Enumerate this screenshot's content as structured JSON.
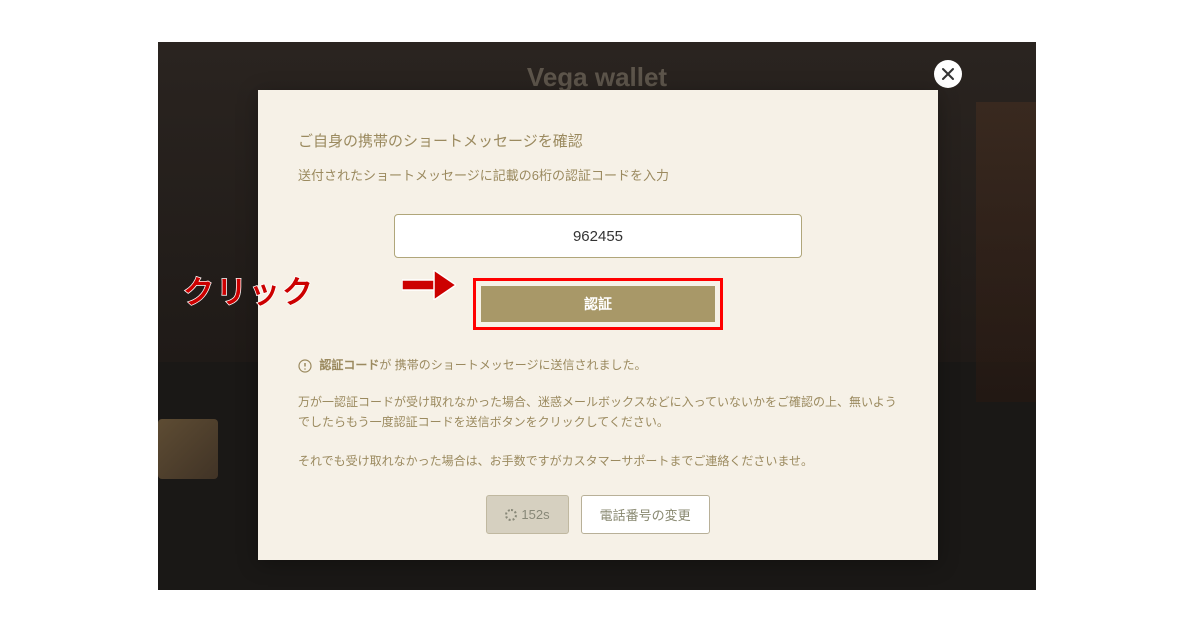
{
  "backdrop": {
    "title": "Vega wallet"
  },
  "modal": {
    "title": "ご自身の携帯のショートメッセージを確認",
    "subtitle": "送付されたショートメッセージに記載の6桁の認証コードを入力",
    "code_value": "962455",
    "verify_button_label": "認証",
    "info_prefix": "認証コード",
    "info_text": "が 携帯のショートメッセージに送信されました。",
    "body_text_1": "万が一認証コードが受け取れなかった場合、迷惑メールボックスなどに入っていないかをご確認の上、無いようでしたらもう一度認証コードを送信ボタンをクリックしてください。",
    "body_text_2": "それでも受け取れなかった場合は、お手数ですがカスタマーサポートまでご連絡くださいませ。",
    "timer_label": "152s",
    "change_phone_label": "電話番号の変更"
  },
  "annotation": {
    "click_label": "クリック"
  }
}
